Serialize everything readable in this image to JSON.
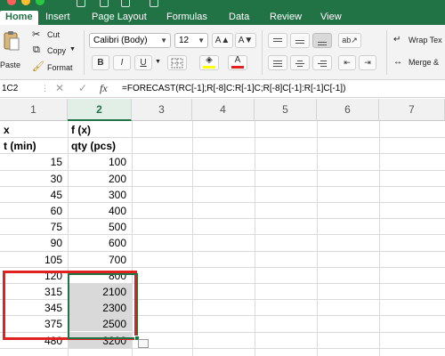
{
  "window": {
    "traffic_lights": [
      "#fe5f57",
      "#febc2e",
      "#28c840"
    ],
    "accent": "#217346"
  },
  "ribbon_tabs": [
    {
      "label": "Home",
      "active": true
    },
    {
      "label": "Insert"
    },
    {
      "label": "Page Layout"
    },
    {
      "label": "Formulas"
    },
    {
      "label": "Data"
    },
    {
      "label": "Review"
    },
    {
      "label": "View"
    }
  ],
  "clipboard": {
    "paste_label": "Paste",
    "cut_label": "Cut",
    "copy_label": "Copy",
    "format_label": "Format"
  },
  "font": {
    "name": "Calibri (Body)",
    "size": "12",
    "grow": "A▲",
    "shrink": "A▼",
    "bold": "B",
    "italic": "I",
    "underline": "U",
    "fill_color": "#ffff00",
    "font_color": "#e0211f"
  },
  "alignment": {
    "wrap_text_label": "Wrap Tex",
    "merge_label": "Merge &"
  },
  "formula_bar": {
    "name_box": "1C2",
    "fx": "fx",
    "formula": "=FORECAST(RC[-1];R[-8]C:R[-1]C;R[-8]C[-1]:R[-1]C[-1])"
  },
  "grid": {
    "columns": [
      "1",
      "2",
      "3",
      "4",
      "5",
      "6",
      "7"
    ],
    "selected_column": "2",
    "header_rows": [
      [
        "x",
        "f (x)"
      ],
      [
        "t (min)",
        "qty (pcs)"
      ]
    ],
    "data_rows": [
      [
        "15",
        "100"
      ],
      [
        "30",
        "200"
      ],
      [
        "45",
        "300"
      ],
      [
        "60",
        "400"
      ],
      [
        "75",
        "500"
      ],
      [
        "90",
        "600"
      ],
      [
        "105",
        "700"
      ],
      [
        "120",
        "800"
      ]
    ],
    "forecast_rows": [
      [
        "315",
        "2100"
      ],
      [
        "345",
        "2300"
      ],
      [
        "375",
        "2500"
      ],
      [
        "480",
        "3200"
      ]
    ],
    "highlight_color": "#e0211f",
    "selection_color": "#217346"
  }
}
